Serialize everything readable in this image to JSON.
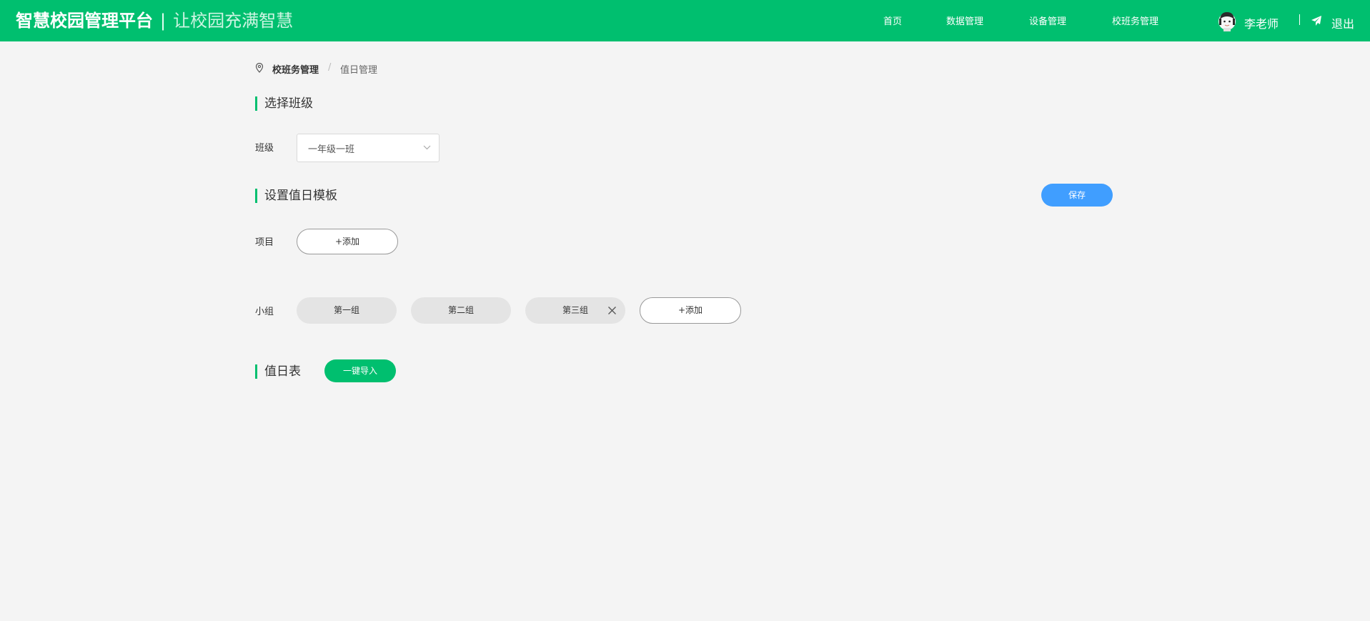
{
  "header": {
    "title": "智慧校园管理平台",
    "divider": "|",
    "slogan": "让校园充满智慧",
    "nav": [
      "首页",
      "数据管理",
      "设备管理",
      "校班务管理"
    ],
    "user_name": "李老师",
    "logout": "退出",
    "bg_color": "#00bf6f"
  },
  "breadcrumb": {
    "items": [
      "校班务管理",
      "值日管理"
    ],
    "separator": "/"
  },
  "section_class": {
    "title": "选择班级",
    "label": "班级",
    "selected": "一年级一班"
  },
  "section_template": {
    "title": "设置值日模板",
    "save": "保存",
    "item_label": "项目",
    "item_add": "+添加",
    "group_label": "小组",
    "groups": [
      "第一组",
      "第二组",
      "第三组"
    ],
    "group_add": "+添加"
  },
  "section_duty": {
    "title": "值日表",
    "import": "一键导入"
  },
  "colors": {
    "accent": "#00bf6f",
    "primary_button": "#409eff",
    "background": "#f4f4f4"
  }
}
